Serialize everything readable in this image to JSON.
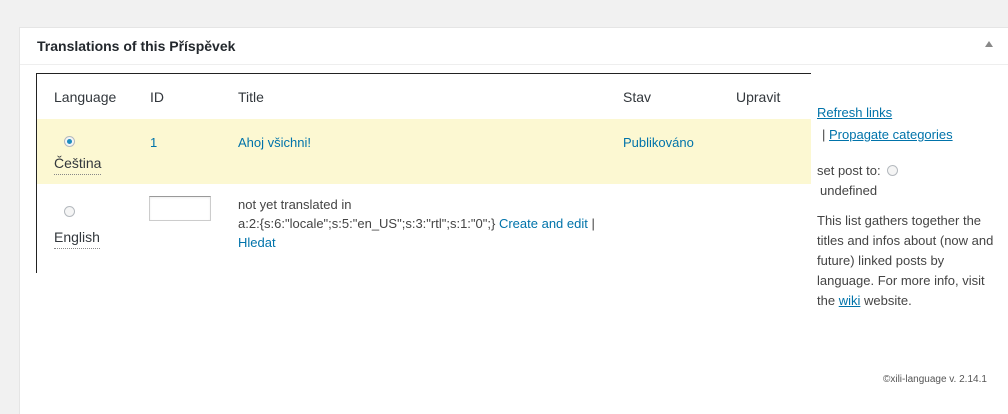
{
  "metabox": {
    "title": "Translations of this Příspěvek"
  },
  "table": {
    "headers": {
      "language": "Language",
      "id": "ID",
      "title": "Title",
      "status": "Stav",
      "edit": "Upravit"
    },
    "rows": [
      {
        "language": "Čeština",
        "id": "1",
        "title": "Ahoj všichni!",
        "status": "Publikováno",
        "selected": true
      },
      {
        "language": "English",
        "id": "",
        "title_prefix": "not yet translated in",
        "title_locale": "a:2:{s:6:\"locale\";s:5:\"en_US\";s:3:\"rtl\";s:1:\"0\";}",
        "create_edit_link": "Create and edit",
        "separator": "|",
        "search_link": "Hledat",
        "selected": false
      }
    ]
  },
  "side": {
    "refresh_link": "Refresh links",
    "separator": "|",
    "propagate_link": "Propagate categories",
    "set_post_to_label": "set post to:",
    "undefined_label": "undefined",
    "help_text": "This list gathers together the titles and infos about (now and future) linked posts by language. For more info, visit the",
    "wiki_link": "wiki",
    "help_suffix": "website."
  },
  "footer": {
    "credit": "©xili-language v. 2.14.1"
  },
  "colors": {
    "link": "#0073aa",
    "current_row_bg": "#fcf8d2",
    "page_bg": "#f1f1f1"
  }
}
